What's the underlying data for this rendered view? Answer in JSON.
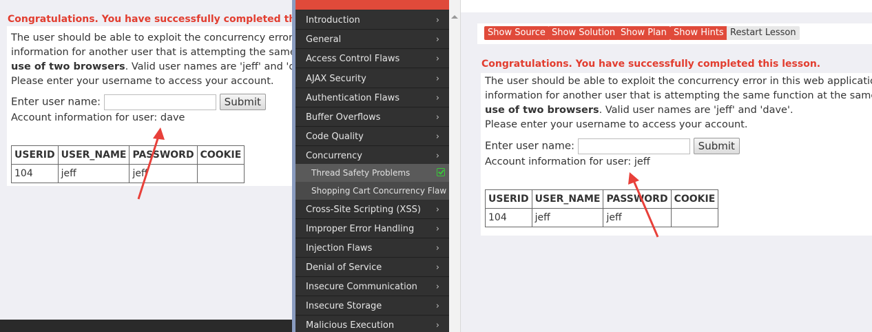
{
  "lesson": {
    "congrats": "Congratulations. You have successfully completed this lesson.",
    "desc_line1": "The user should be able to exploit the concurrency error in this web application and",
    "desc_line2": "information for another user that is attempting the same function at the same time.",
    "desc_line3_bold": "use of two browsers",
    "desc_line3_rest": ". Valid user names are 'jeff' and 'dave'.",
    "desc_line4": "Please enter your username to access your account.",
    "username_label": "Enter user name:",
    "username_value": "",
    "submit_label": "Submit",
    "table_headers": [
      "USERID",
      "USER_NAME",
      "PASSWORD",
      "COOKIE"
    ]
  },
  "left": {
    "congrats_visible": "Congratulations. You have successfully completed this lesso",
    "desc_line1": "The user should be able to exploit the concurrency error in th",
    "desc_line2": "information for another user that is attempting the same fun",
    "account_info": "Account information for user: dave",
    "row": [
      "104",
      "jeff",
      "jeff",
      ""
    ]
  },
  "right": {
    "account_info": "Account information for user: jeff",
    "row": [
      "104",
      "jeff",
      "jeff",
      ""
    ]
  },
  "toolbar": {
    "show_source": "Show Source",
    "show_solution": "Show Solution",
    "show_plan": "Show Plan",
    "show_hints": "Show Hints",
    "restart": "Restart Lesson"
  },
  "sidebar": {
    "items": [
      {
        "label": "Introduction"
      },
      {
        "label": "General"
      },
      {
        "label": "Access Control Flaws"
      },
      {
        "label": "AJAX Security"
      },
      {
        "label": "Authentication Flaws"
      },
      {
        "label": "Buffer Overflows"
      },
      {
        "label": "Code Quality"
      },
      {
        "label": "Concurrency"
      },
      {
        "label": "Cross-Site Scripting (XSS)"
      },
      {
        "label": "Improper Error Handling"
      },
      {
        "label": "Injection Flaws"
      },
      {
        "label": "Denial of Service"
      },
      {
        "label": "Insecure Communication"
      },
      {
        "label": "Insecure Storage"
      },
      {
        "label": "Malicious Execution"
      }
    ],
    "subitems": [
      {
        "label": "Thread Safety Problems",
        "completed": true
      },
      {
        "label": "Shopping Cart Concurrency Flaw",
        "completed": false
      }
    ],
    "chevron": "›"
  },
  "colors": {
    "accent_red": "#e04a3a",
    "congrats_red": "#e23d2f",
    "sidebar_bg": "#313131",
    "check_green": "#38c838",
    "arrow_red": "#e8403a"
  },
  "icons": {
    "chevron": "chevron-right-icon",
    "check": "check-icon",
    "arrow": "arrow-annotation-icon"
  }
}
